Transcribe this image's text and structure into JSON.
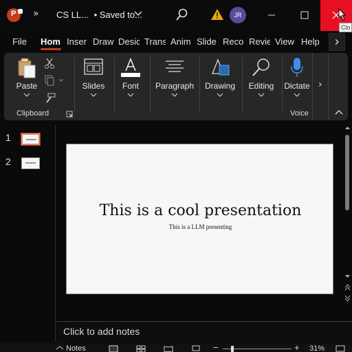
{
  "titlebar": {
    "app_letter": "P",
    "qat_more": "»",
    "doc_name": "CS LL...",
    "doc_status": "•  Saved to...",
    "avatar_initials": "JR",
    "close_tooltip": "Clo"
  },
  "tabs": [
    {
      "label": "File",
      "active": false
    },
    {
      "label": "Hom",
      "active": true
    },
    {
      "label": "Inser",
      "active": false
    },
    {
      "label": "Draw",
      "active": false
    },
    {
      "label": "Desic",
      "active": false
    },
    {
      "label": "Trans",
      "active": false
    },
    {
      "label": "Anim",
      "active": false
    },
    {
      "label": "Slide",
      "active": false
    },
    {
      "label": "Reco",
      "active": false
    },
    {
      "label": "Revie",
      "active": false
    },
    {
      "label": "View",
      "active": false
    },
    {
      "label": "Help",
      "active": false
    }
  ],
  "ribbon": {
    "paste": "Paste",
    "clipboard_group": "Clipboard",
    "slides": "Slides",
    "font": "Font",
    "paragraph": "Paragraph",
    "drawing": "Drawing",
    "editing": "Editing",
    "dictate": "Dictate",
    "voice_group": "Voice",
    "scroll_arrow": "›"
  },
  "slide_panel": {
    "items": [
      {
        "number": "1",
        "selected": true
      },
      {
        "number": "2",
        "selected": false
      }
    ]
  },
  "slide": {
    "title": "This is a cool presentation",
    "subtitle": "This is a LLM presenting"
  },
  "notes": {
    "placeholder": "Click to add notes"
  },
  "statusbar": {
    "notes_label": "Notes",
    "zoom_minus": "−",
    "zoom_plus": "+",
    "zoom_level": "31%"
  },
  "colors": {
    "accent": "#c43e1c",
    "close_red": "#e81123",
    "ribbon_bg": "#272727",
    "avatar_bg": "#5a4b9b"
  }
}
